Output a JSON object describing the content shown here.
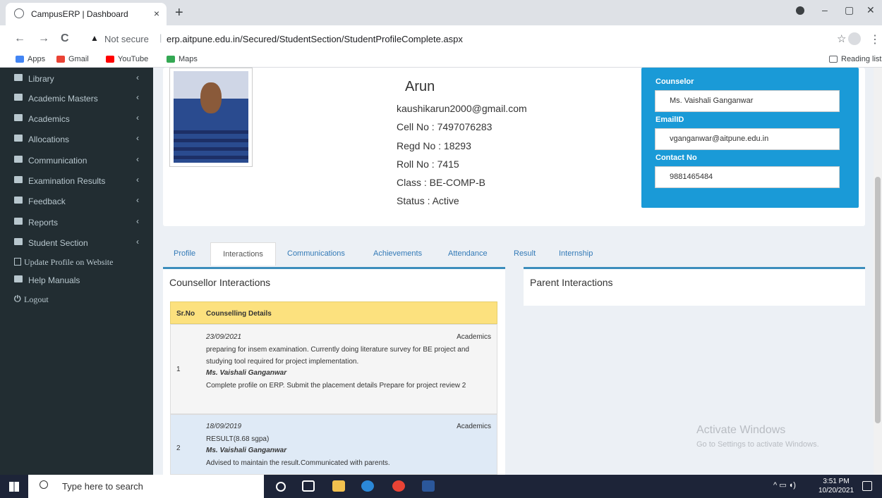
{
  "browser": {
    "tab_title": "CampusERP | Dashboard",
    "tab_close": "×",
    "new_tab": "+",
    "win_min": "–",
    "win_max": "▢",
    "win_close": "✕",
    "back": "←",
    "forward": "→",
    "reload": "C",
    "not_secure": "Not secure",
    "url": "erp.aitpune.edu.in/Secured/StudentSection/StudentProfileComplete.aspx",
    "star": "☆",
    "menu": "⋮"
  },
  "bookmarks": {
    "apps": "Apps",
    "gmail": "Gmail",
    "youtube": "YouTube",
    "maps": "Maps",
    "reading_list": "Reading list"
  },
  "sidebar": {
    "items": [
      {
        "label": "Library",
        "caret": "‹"
      },
      {
        "label": "Academic Masters",
        "caret": "‹"
      },
      {
        "label": "Academics",
        "caret": "‹"
      },
      {
        "label": "Allocations",
        "caret": "‹"
      },
      {
        "label": "Communication",
        "caret": "‹"
      },
      {
        "label": "Examination Results",
        "caret": "‹"
      },
      {
        "label": "Feedback",
        "caret": "‹"
      },
      {
        "label": "Reports",
        "caret": "‹"
      },
      {
        "label": "Student Section",
        "caret": "‹"
      },
      {
        "label": "Update Profile on Website"
      },
      {
        "label": "Help Manuals"
      },
      {
        "label": "Logout"
      }
    ]
  },
  "profile": {
    "name": "Arun",
    "email": "kaushikarun2000@gmail.com",
    "cell": "Cell No : 7497076283",
    "regd": "Regd No : 18293",
    "roll": "Roll No : 7415",
    "class": "Class : BE-COMP-B",
    "status": "Status : Active"
  },
  "counselor": {
    "counselor_label": "Counselor",
    "counselor_value": "Ms. Vaishali Ganganwar",
    "email_label": "EmailID",
    "email_value": "vganganwar@aitpune.edu.in",
    "contact_label": "Contact No",
    "contact_value": "9881465484"
  },
  "tabs": [
    "Profile",
    "Interactions",
    "Communications",
    "Achievements",
    "Attendance",
    "Result",
    "Internship"
  ],
  "counsellor_panel": {
    "title": "Counsellor Interactions",
    "col_sr": "Sr.No",
    "col_details": "Counselling Details",
    "rows": [
      {
        "sr": "1",
        "date": "23/09/2021",
        "category": "Academics",
        "text": "preparing for insem examination. Currently doing literature survey for BE project and studying tool required for project implementation.",
        "counselor": "Ms. Vaishali Ganganwar",
        "remark": "Complete profile on ERP. Submit the placement details Prepare for project review 2"
      },
      {
        "sr": "2",
        "date": "18/09/2019",
        "category": "Academics",
        "text": "RESULT(8.68 sgpa)",
        "counselor": "Ms. Vaishali Ganganwar",
        "remark": "Advised to maintain the result.Communicated with parents."
      }
    ]
  },
  "parent_panel": {
    "title": "Parent Interactions"
  },
  "watermark": {
    "line1": "Activate Windows",
    "line2": "Go to Settings to activate Windows."
  },
  "taskbar": {
    "search_placeholder": "Type here to search",
    "time": "3:51 PM",
    "date": "10/20/2021"
  }
}
